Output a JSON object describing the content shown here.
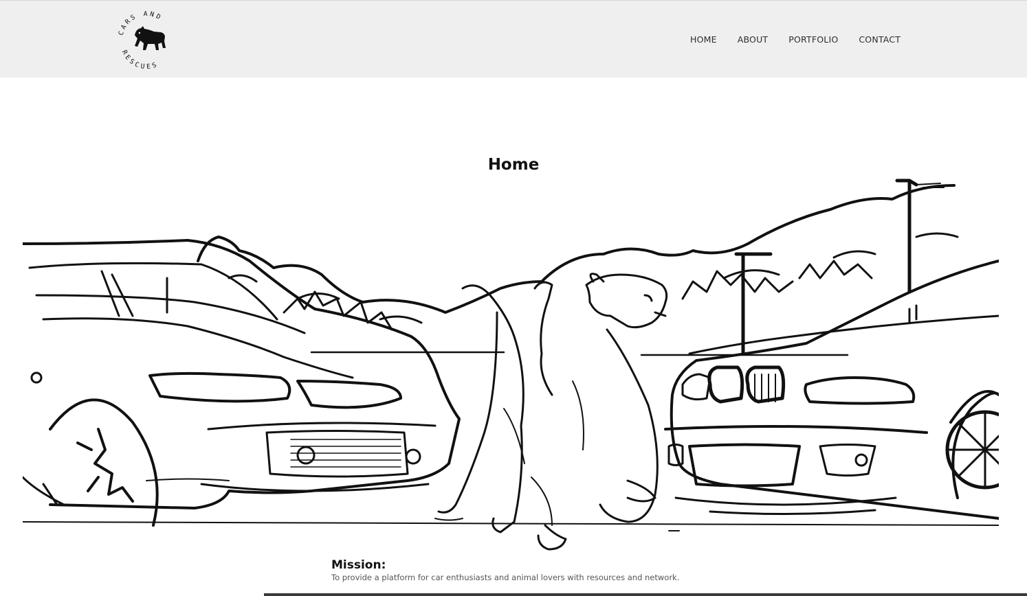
{
  "header": {
    "logo_icon": "dog-icon",
    "logo_text_top": "CARS AND",
    "logo_text_bottom": "RESCUES",
    "nav": [
      {
        "label": "HOME"
      },
      {
        "label": "ABOUT"
      },
      {
        "label": "PORTFOLIO"
      },
      {
        "label": "CONTACT"
      }
    ]
  },
  "main": {
    "title": "Home",
    "hero_image": "line-art-two-cars-and-dog-illustration"
  },
  "mission": {
    "heading": "Mission:",
    "text": "To provide a platform for car enthusiasts and animal lovers with resources and network."
  }
}
